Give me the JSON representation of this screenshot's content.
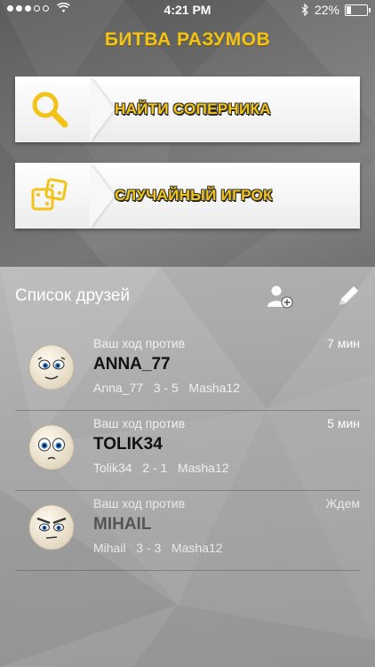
{
  "status_bar": {
    "time": "4:21 PM",
    "battery": "22%",
    "battery_level": 0.22,
    "signal_dots_filled": 3,
    "signal_dots_total": 5
  },
  "app_title": "БИТВА РАЗУМОВ",
  "actions": {
    "find_opponent": {
      "label": "НАЙТИ СОПЕРНИКА",
      "icon": "search-icon"
    },
    "random_player": {
      "label": "СЛУЧАЙНЫЙ ИГРОК",
      "icon": "dice-icon"
    }
  },
  "friends": {
    "header": "Список друзей",
    "add_icon": "add-user-icon",
    "edit_icon": "pencil-icon",
    "items": [
      {
        "turn_text": "Ваш ход против",
        "time": "7 мин",
        "name": "ANNA_77",
        "score": "Anna_77   3 - 5   Masha12"
      },
      {
        "turn_text": "Ваш ход против",
        "time": "5 мин",
        "name": "TOLIK34",
        "score": "Tolik34   2 - 1   Masha12"
      },
      {
        "turn_text": "Ваш ход против",
        "time": "Ждем",
        "name": "MIHAIL",
        "score": "Mihail   3 - 3   Masha12"
      }
    ]
  },
  "colors": {
    "accent_yellow": "#f2c318",
    "text_white": "#ffffff",
    "text_dark": "#111111"
  }
}
